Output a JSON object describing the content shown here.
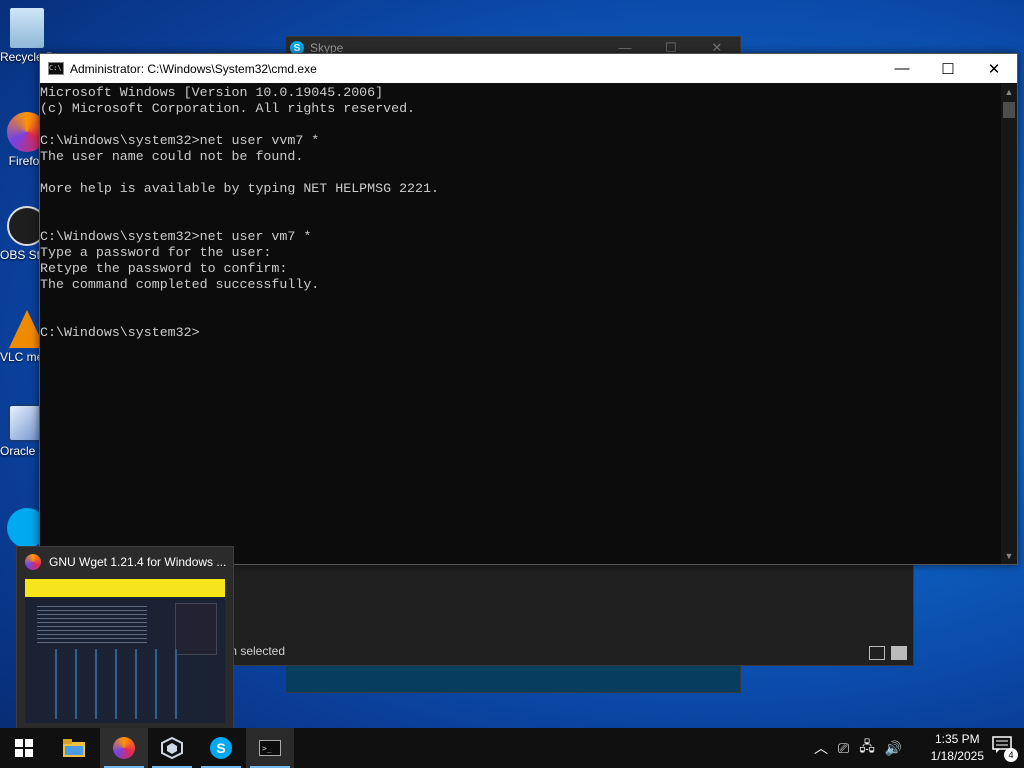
{
  "desktop": {
    "icons": [
      {
        "label": "Recycle Bin"
      },
      {
        "label": "Firefox"
      },
      {
        "label": "OBS Studio"
      },
      {
        "label": "VLC media player"
      },
      {
        "label": "Oracle VM VirtualBox"
      },
      {
        "label": "Skype"
      }
    ]
  },
  "skype_window": {
    "title": "Skype",
    "icon_letter": "S"
  },
  "explorer_window": {
    "status": "m selected"
  },
  "cmd_window": {
    "title": "Administrator: C:\\Windows\\System32\\cmd.exe",
    "lines": [
      "Microsoft Windows [Version 10.0.19045.2006]",
      "(c) Microsoft Corporation. All rights reserved.",
      "",
      "C:\\Windows\\system32>net user vvm7 *",
      "The user name could not be found.",
      "",
      "More help is available by typing NET HELPMSG 2221.",
      "",
      "",
      "C:\\Windows\\system32>net user vm7 *",
      "Type a password for the user:",
      "Retype the password to confirm:",
      "The command completed successfully.",
      "",
      "",
      "C:\\Windows\\system32>"
    ]
  },
  "preview": {
    "title": "GNU Wget 1.21.4 for Windows ..."
  },
  "taskbar": {
    "time": "1:35 PM",
    "date": "1/18/2025",
    "notification_count": "4"
  }
}
